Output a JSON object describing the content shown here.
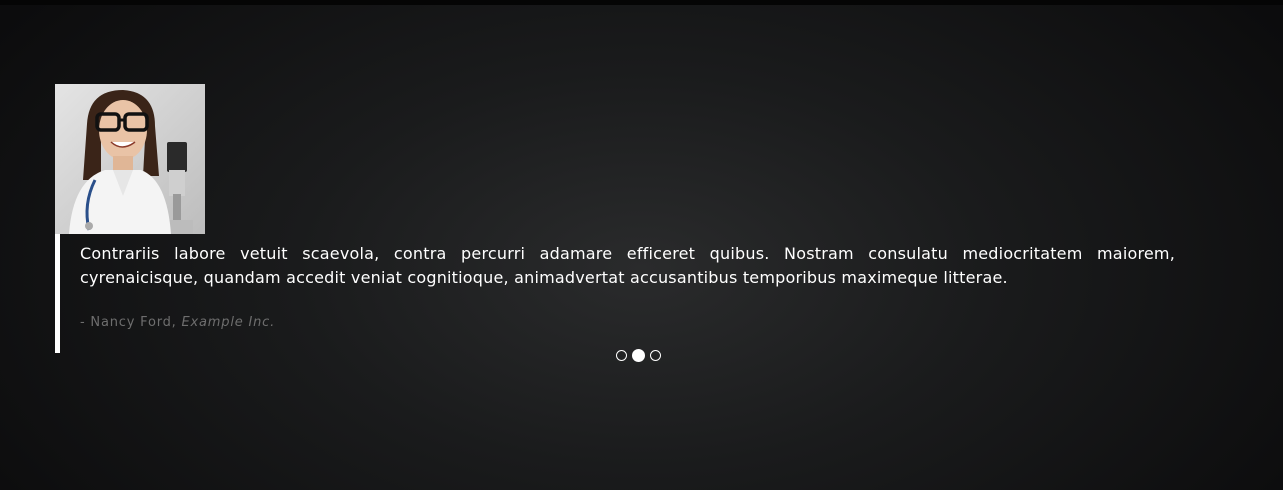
{
  "testimonial": {
    "quote": "Contrariis labore vetuit scaevola, contra percurri adamare efficeret quibus. Nostram consulatu mediocritatem maiorem, cyrenaicisque, quandam accedit veniat cognitioque, animadvertat accusantibus temporibus maximeque litterae.",
    "author_prefix": "- Nancy Ford, ",
    "company": "Example Inc.",
    "avatar_icon": "person-photo-icon"
  },
  "pager": {
    "count": 3,
    "active_index": 1
  },
  "colors": {
    "text": "#ffffff",
    "author": "#6e6e6e",
    "accent_border": "#ffffff"
  }
}
